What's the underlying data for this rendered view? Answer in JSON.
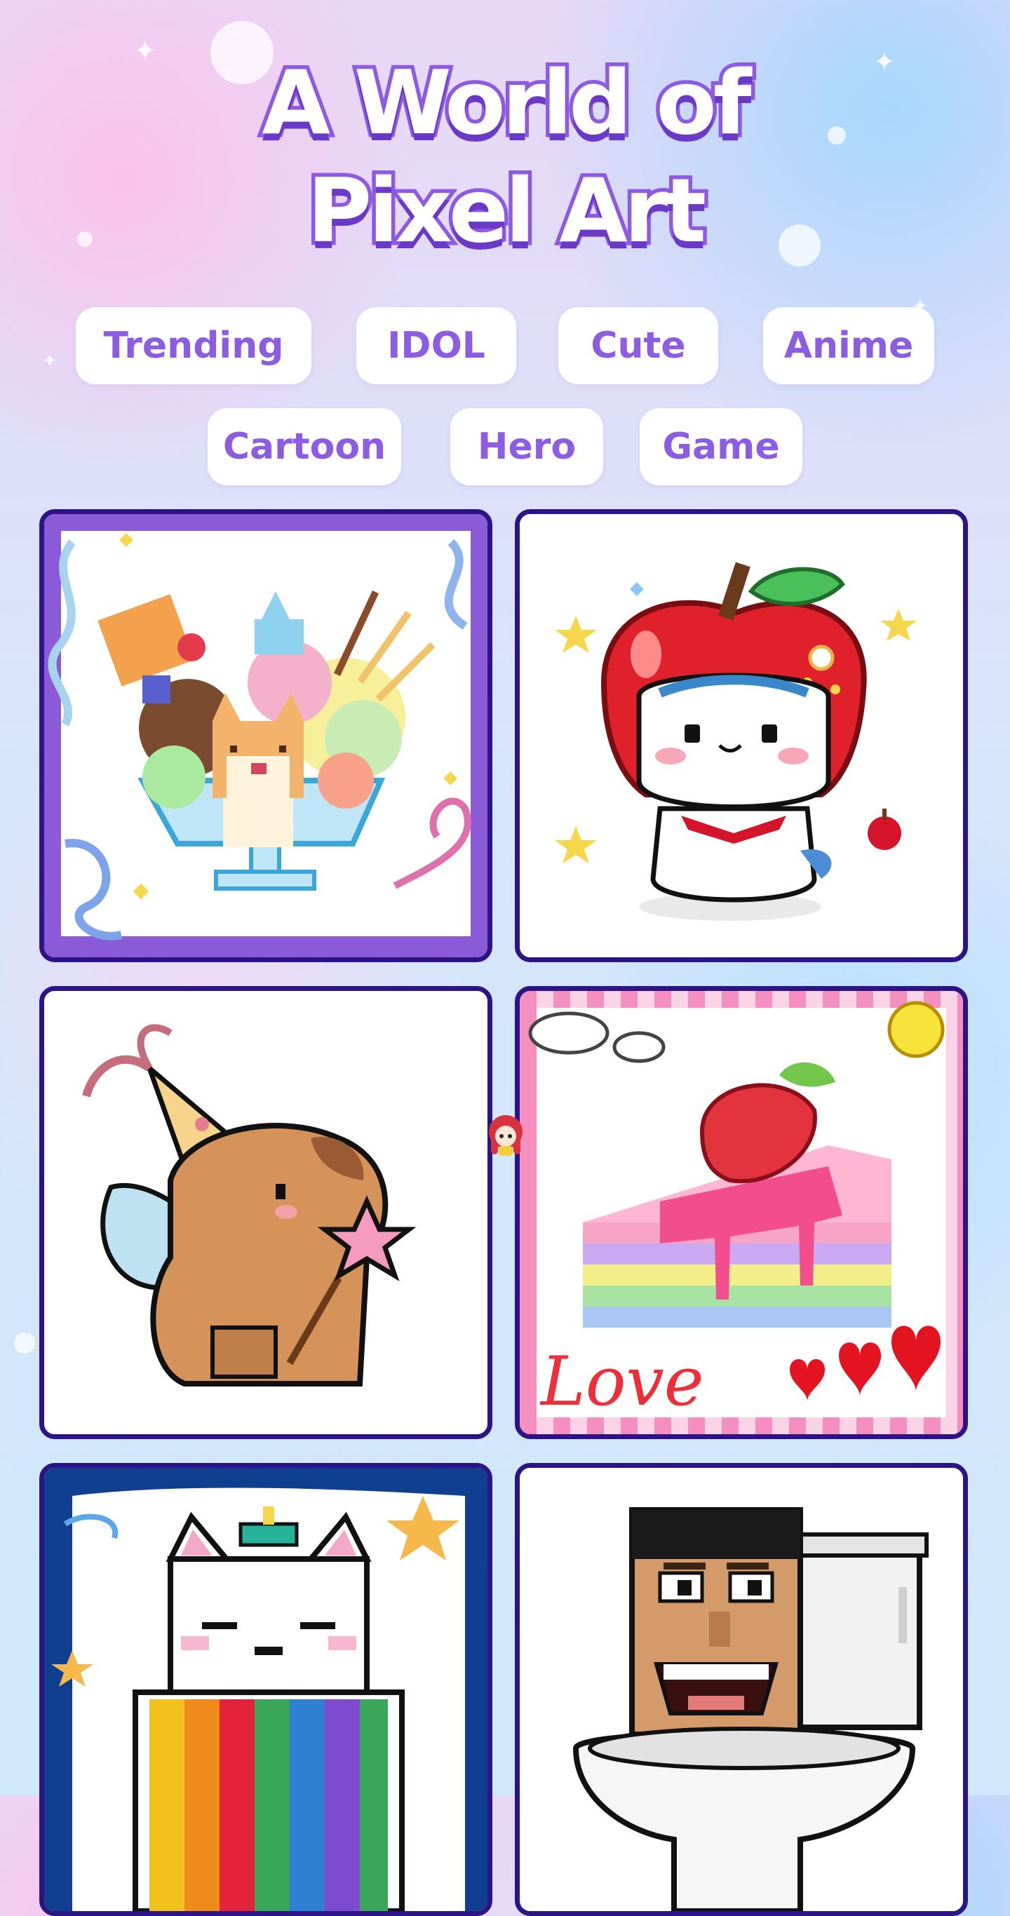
{
  "title": {
    "line1": "A World of",
    "line2": "Pixel Art"
  },
  "categories": [
    {
      "label": "Trending"
    },
    {
      "label": "IDOL"
    },
    {
      "label": "Cute"
    },
    {
      "label": "Anime"
    },
    {
      "label": "Cartoon"
    },
    {
      "label": "Hero"
    },
    {
      "label": "Game"
    }
  ],
  "gallery": [
    {
      "subject": "kitten-ice-cream-sundae",
      "frame": "purple",
      "selected": true
    },
    {
      "subject": "apple-hat-bunny",
      "frame": "white",
      "selected": false
    },
    {
      "subject": "capybara-party-fairy",
      "frame": "white",
      "selected": false
    },
    {
      "subject": "rainbow-strawberry-cake-love",
      "frame": "pink-checker",
      "selected": false
    },
    {
      "subject": "rainbow-cat-clown",
      "frame": "blue",
      "selected": false
    },
    {
      "subject": "toilet-head-character",
      "frame": "white",
      "selected": false
    }
  ],
  "colors": {
    "accent": "#8c5de2",
    "card_border": "#2c1486",
    "title_outline": "#8e5ae3",
    "selected_frame": "#8a5ad8"
  }
}
